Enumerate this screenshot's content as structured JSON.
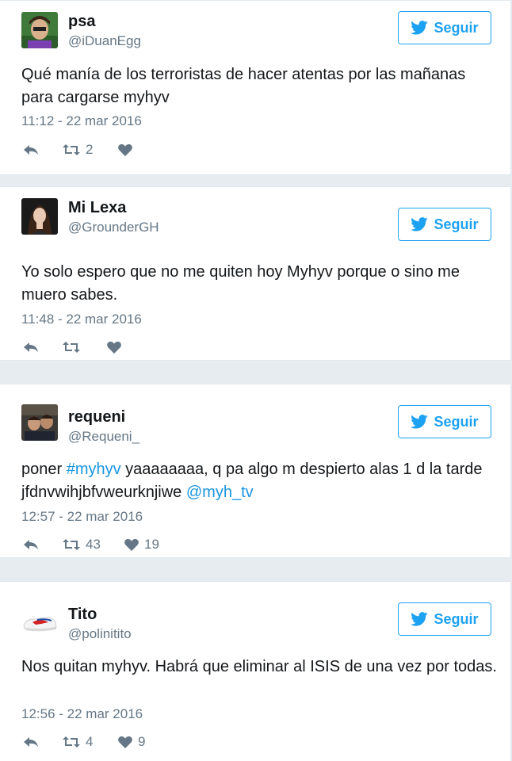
{
  "follow_label": "Seguir",
  "colors": {
    "accent": "#1da1f2",
    "link": "#1b95e0",
    "muted": "#657786",
    "text": "#14171a",
    "background": "#e6ecf0"
  },
  "icons": {
    "follow": "twitter-bird-icon",
    "reply": "reply-icon",
    "retweet": "retweet-icon",
    "like": "heart-icon"
  },
  "tweets": [
    {
      "name": "psa",
      "handle": "@iDuanEgg",
      "text": "Qué manía de los terroristas de hacer atentas por las mañanas para cargarse myhyv",
      "timestamp": "11:12 - 22 mar 2016",
      "retweets": "2",
      "likes": ""
    },
    {
      "name": "Mi Lexa",
      "handle": "@GrounderGH",
      "text": "Yo solo espero que no me quiten hoy Myhyv porque o sino me muero sabes.",
      "timestamp": "11:48 - 22 mar 2016",
      "retweets": "",
      "likes": ""
    },
    {
      "name": "requeni",
      "handle": "@Requeni_",
      "text_before": "poner ",
      "hashtag": "#myhyv",
      "text_middle": " yaaaaaaaa, q pa algo m despierto alas 1 d la tarde jfdnvwihjbfvweurknjiwe ",
      "mention": "@myh_tv",
      "timestamp": "12:57 - 22 mar 2016",
      "retweets": "43",
      "likes": "19"
    },
    {
      "name": "Tito",
      "handle": "@polinitito",
      "text": "Nos quitan myhyv. Habrá que eliminar al ISIS de una vez por todas.",
      "timestamp": "12:56 - 22 mar 2016",
      "retweets": "4",
      "likes": "9"
    }
  ]
}
